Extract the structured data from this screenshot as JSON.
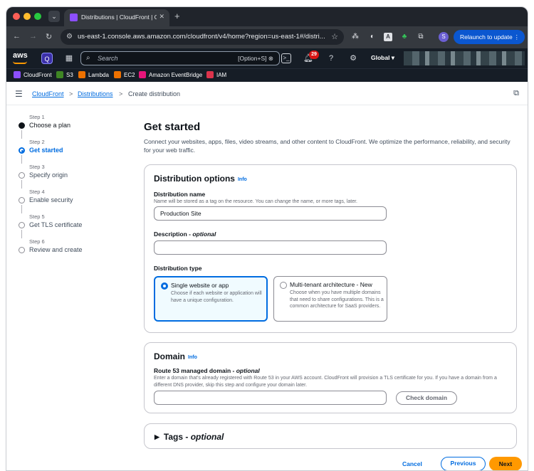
{
  "browser": {
    "tab_title": "Distributions | CloudFront | Gl",
    "url": "us-east-1.console.aws.amazon.com/cloudfront/v4/home?region=us-east-1#/distri...",
    "relaunch_label": "Relaunch to update",
    "profile_initial": "S"
  },
  "aws_nav": {
    "logo": "aws",
    "search_placeholder": "Search",
    "search_shortcut": "[Option+S]",
    "notification_count": "29",
    "region": "Global ▾"
  },
  "favorites": [
    {
      "label": "CloudFront",
      "color": "#8c4fff"
    },
    {
      "label": "S3",
      "color": "#3f8624"
    },
    {
      "label": "Lambda",
      "color": "#ed7100"
    },
    {
      "label": "EC2",
      "color": "#ed7100"
    },
    {
      "label": "Amazon EventBridge",
      "color": "#e7157b"
    },
    {
      "label": "IAM",
      "color": "#dd344c"
    }
  ],
  "breadcrumb": {
    "items": [
      "CloudFront",
      "Distributions",
      "Create distribution"
    ]
  },
  "steps": [
    {
      "num": "Step 1",
      "name": "Choose a plan"
    },
    {
      "num": "Step 2",
      "name": "Get started"
    },
    {
      "num": "Step 3",
      "name": "Specify origin"
    },
    {
      "num": "Step 4",
      "name": "Enable security"
    },
    {
      "num": "Step 5",
      "name": "Get TLS certificate"
    },
    {
      "num": "Step 6",
      "name": "Review and create"
    }
  ],
  "main": {
    "title": "Get started",
    "description": "Connect your websites, apps, files, video streams, and other content to CloudFront. We optimize the performance, reliability, and security for your web traffic."
  },
  "distribution_options": {
    "heading": "Distribution options",
    "info": "Info",
    "name_label": "Distribution name",
    "name_hint": "Name will be stored as a tag on the resource. You can change the name, or more tags, later.",
    "name_value": "Production Site",
    "description_label": "Description - ",
    "description_optional": "optional",
    "description_value": "",
    "type_label": "Distribution type",
    "tiles": [
      {
        "title": "Single website or app",
        "desc": "Choose if each website or application will have a unique configuration."
      },
      {
        "title": "Multi-tenant architecture - New",
        "desc": "Choose when you have multiple domains that need to share configurations. This is a common architecture for SaaS providers."
      }
    ]
  },
  "domain": {
    "heading": "Domain",
    "info": "Info",
    "label": "Route 53 managed domain - ",
    "label_optional": "optional",
    "hint": "Enter a domain that's already registered with Route 53 in your AWS account. CloudFront will provision a TLS certificate for you. If you have a domain from a different DNS provider, skip this step and configure your domain later.",
    "value": "",
    "check_button": "Check domain"
  },
  "tags": {
    "label": "Tags - ",
    "optional": "optional"
  },
  "footer": {
    "cancel": "Cancel",
    "previous": "Previous",
    "next": "Next"
  }
}
